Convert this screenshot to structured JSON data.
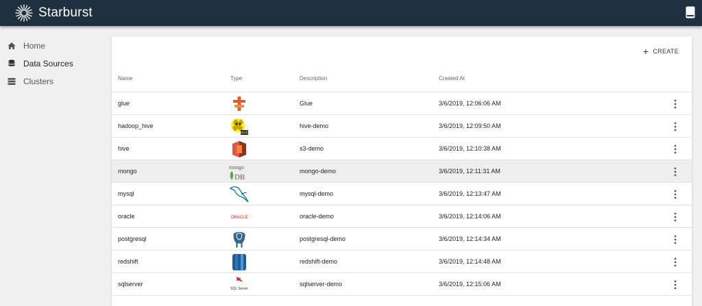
{
  "app": {
    "brand": "Starburst"
  },
  "icons": {
    "brand": "starburst-logo-icon",
    "docs": "book-icon"
  },
  "sidebar": {
    "items": [
      {
        "label": "Home",
        "icon": "home-icon"
      },
      {
        "label": "Data Sources",
        "icon": "database-icon",
        "active": true
      },
      {
        "label": "Clusters",
        "icon": "server-icon"
      }
    ]
  },
  "toolbar": {
    "create_label": "CREATE"
  },
  "table": {
    "columns": [
      "Name",
      "Type",
      "Description",
      "Created At"
    ],
    "rows": [
      {
        "name": "glue",
        "type_icon": "aws-glue-logo",
        "description": "Glue",
        "created_at": "3/6/2019, 12:06:06 AM"
      },
      {
        "name": "hadoop_hive",
        "type_icon": "hive-logo",
        "description": "hive-demo",
        "created_at": "3/6/2019, 12:09:50 AM"
      },
      {
        "name": "hive",
        "type_icon": "aws-s3-logo",
        "description": "s3-demo",
        "created_at": "3/6/2019, 12:10:38 AM"
      },
      {
        "name": "mongo",
        "type_icon": "mongodb-logo",
        "type_text": "mongo",
        "type_text2": "DB",
        "description": "mongo-demo",
        "created_at": "3/6/2019, 12:11:31 AM",
        "highlighted": true
      },
      {
        "name": "mysql",
        "type_icon": "mysql-logo",
        "description": "mysql-demo",
        "created_at": "3/6/2019, 12:13:47 AM"
      },
      {
        "name": "oracle",
        "type_icon": "oracle-logo",
        "type_text": "ORACLE",
        "description": "oracle-demo",
        "created_at": "3/6/2019, 12:14:06 AM"
      },
      {
        "name": "postgresql",
        "type_icon": "postgresql-logo",
        "description": "postgresql-demo",
        "created_at": "3/6/2019, 12:14:34 AM"
      },
      {
        "name": "redshift",
        "type_icon": "aws-redshift-logo",
        "description": "redshift-demo",
        "created_at": "3/6/2019, 12:14:48 AM"
      },
      {
        "name": "sqlserver",
        "type_icon": "sqlserver-logo",
        "type_text": "SQL Server",
        "description": "sqlserver-demo",
        "created_at": "3/6/2019, 12:15:06 AM"
      }
    ]
  },
  "colors": {
    "topbar": "#1f3140",
    "row_highlight": "#eeeeee",
    "oracle_red": "#e2231a",
    "aws_orange": "#e15d28",
    "redshift_blue": "#205b99"
  }
}
